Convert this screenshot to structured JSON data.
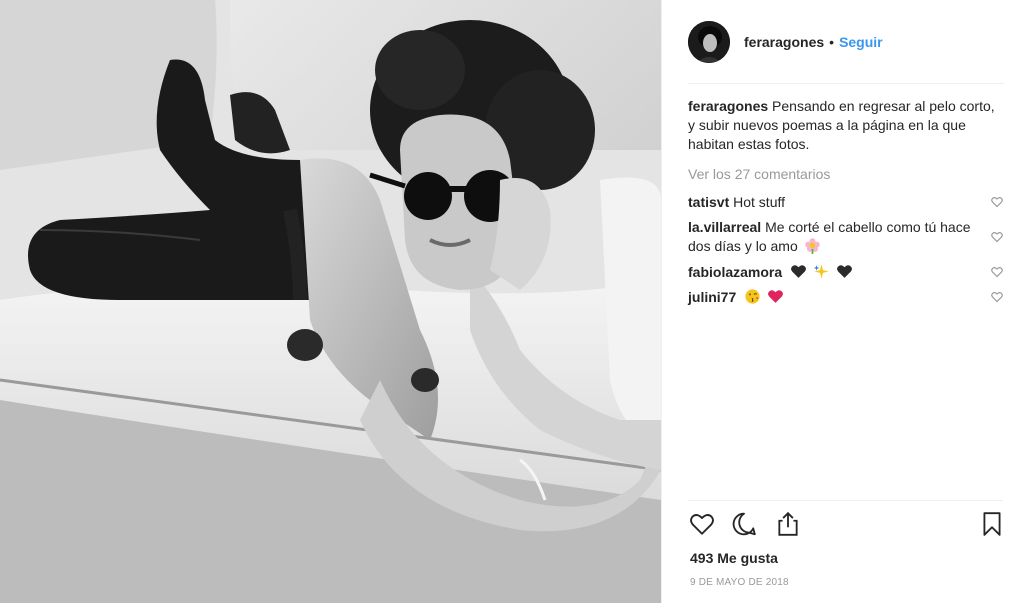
{
  "post": {
    "image_alt": "black-and-white photo of a woman with curly hair and sunglasses lying on a white sofa"
  },
  "header": {
    "username": "feraragones",
    "separator": "•",
    "follow_label": "Seguir"
  },
  "caption": {
    "username": "feraragones",
    "text": "Pensando en regresar al pelo corto, y subir nuevos poemas a la página en la que habitan estas fotos."
  },
  "view_comments_label": "Ver los 27 comentarios",
  "comments": [
    {
      "username": "tatisvt",
      "text": "Hot stuff",
      "emojis": []
    },
    {
      "username": "la.villarreal",
      "text": "Me corté el cabello como tú hace dos días y lo amo",
      "emojis": [
        "flower-icon"
      ]
    },
    {
      "username": "fabiolazamora",
      "text": "",
      "emojis": [
        "black-heart-icon",
        "sparkle-icon",
        "black-heart-icon"
      ]
    },
    {
      "username": "julini77",
      "text": "",
      "emojis": [
        "kiss-face-icon",
        "red-heart-icon"
      ]
    }
  ],
  "likes_label": "493 Me gusta",
  "date_label": "9 DE MAYO DE 2018",
  "colors": {
    "link": "#3897f0",
    "muted": "#999999",
    "text": "#262626",
    "divider": "#efefef"
  },
  "icons": {
    "like": "heart-outline-icon",
    "comment": "speech-bubble-icon",
    "share": "share-upload-icon",
    "save": "bookmark-icon"
  }
}
